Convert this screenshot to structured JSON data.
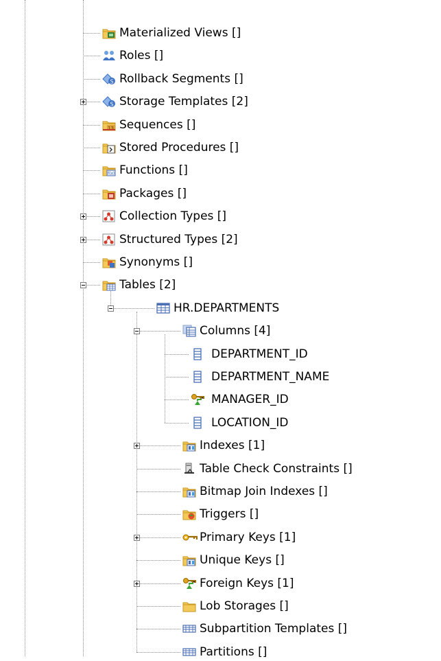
{
  "tree": {
    "nodes": [
      {
        "label": "Materialized Views []",
        "icon": "materialized-view-folder-icon",
        "expander": "none",
        "level": 0
      },
      {
        "label": "Roles []",
        "icon": "roles-icon",
        "expander": "none",
        "level": 0
      },
      {
        "label": "Rollback Segments []",
        "icon": "rollback-segment-icon",
        "expander": "none",
        "level": 0
      },
      {
        "label": "Storage Templates [2]",
        "icon": "storage-template-icon",
        "expander": "plus",
        "level": 0
      },
      {
        "label": "Sequences []",
        "icon": "sequence-folder-icon",
        "expander": "none",
        "level": 0
      },
      {
        "label": "Stored Procedures []",
        "icon": "stored-procedure-folder-icon",
        "expander": "none",
        "level": 0
      },
      {
        "label": "Functions []",
        "icon": "function-folder-icon",
        "expander": "none",
        "level": 0
      },
      {
        "label": "Packages []",
        "icon": "package-folder-icon",
        "expander": "none",
        "level": 0
      },
      {
        "label": "Collection Types []",
        "icon": "collection-type-icon",
        "expander": "plus",
        "level": 0
      },
      {
        "label": "Structured Types [2]",
        "icon": "structured-type-icon",
        "expander": "plus",
        "level": 0
      },
      {
        "label": "Synonyms []",
        "icon": "synonym-folder-icon",
        "expander": "none",
        "level": 0
      },
      {
        "label": "Tables [2]",
        "icon": "table-folder-icon",
        "expander": "minus",
        "level": 0
      },
      {
        "label": "HR.DEPARTMENTS",
        "icon": "table-icon",
        "expander": "minus",
        "level": 1
      },
      {
        "label": "Columns [4]",
        "icon": "columns-icon",
        "expander": "minus",
        "level": 2
      },
      {
        "label": "DEPARTMENT_ID",
        "icon": "column-icon",
        "expander": "none",
        "level": 3
      },
      {
        "label": "DEPARTMENT_NAME",
        "icon": "column-icon",
        "expander": "none",
        "level": 3
      },
      {
        "label": "MANAGER_ID",
        "icon": "foreign-key-column-icon",
        "expander": "none",
        "level": 3
      },
      {
        "label": "LOCATION_ID",
        "icon": "column-icon",
        "expander": "none",
        "level": 3
      },
      {
        "label": "Indexes [1]",
        "icon": "index-folder-icon",
        "expander": "plus",
        "level": 2
      },
      {
        "label": "Table Check Constraints []",
        "icon": "check-constraint-icon",
        "expander": "none",
        "level": 2
      },
      {
        "label": "Bitmap Join Indexes []",
        "icon": "index-folder-icon",
        "expander": "none",
        "level": 2
      },
      {
        "label": "Triggers []",
        "icon": "trigger-folder-icon",
        "expander": "none",
        "level": 2
      },
      {
        "label": "Primary Keys [1]",
        "icon": "primary-key-icon",
        "expander": "plus",
        "level": 2
      },
      {
        "label": "Unique Keys []",
        "icon": "index-folder-icon",
        "expander": "none",
        "level": 2
      },
      {
        "label": "Foreign Keys [1]",
        "icon": "foreign-key-icon",
        "expander": "plus",
        "level": 2
      },
      {
        "label": "Lob Storages []",
        "icon": "folder-icon",
        "expander": "none",
        "level": 2
      },
      {
        "label": "Subpartition Templates []",
        "icon": "subpartition-template-icon",
        "expander": "none",
        "level": 2
      },
      {
        "label": "Partitions []",
        "icon": "partition-icon",
        "expander": "none",
        "level": 2
      }
    ]
  },
  "colors": {
    "folder": "#f3c95a",
    "folder_dark": "#c9961f",
    "table_blue": "#4a6fb5",
    "key_gold": "#e0a21c",
    "key_green": "#3aa636",
    "type_red": "#d23a2a"
  }
}
